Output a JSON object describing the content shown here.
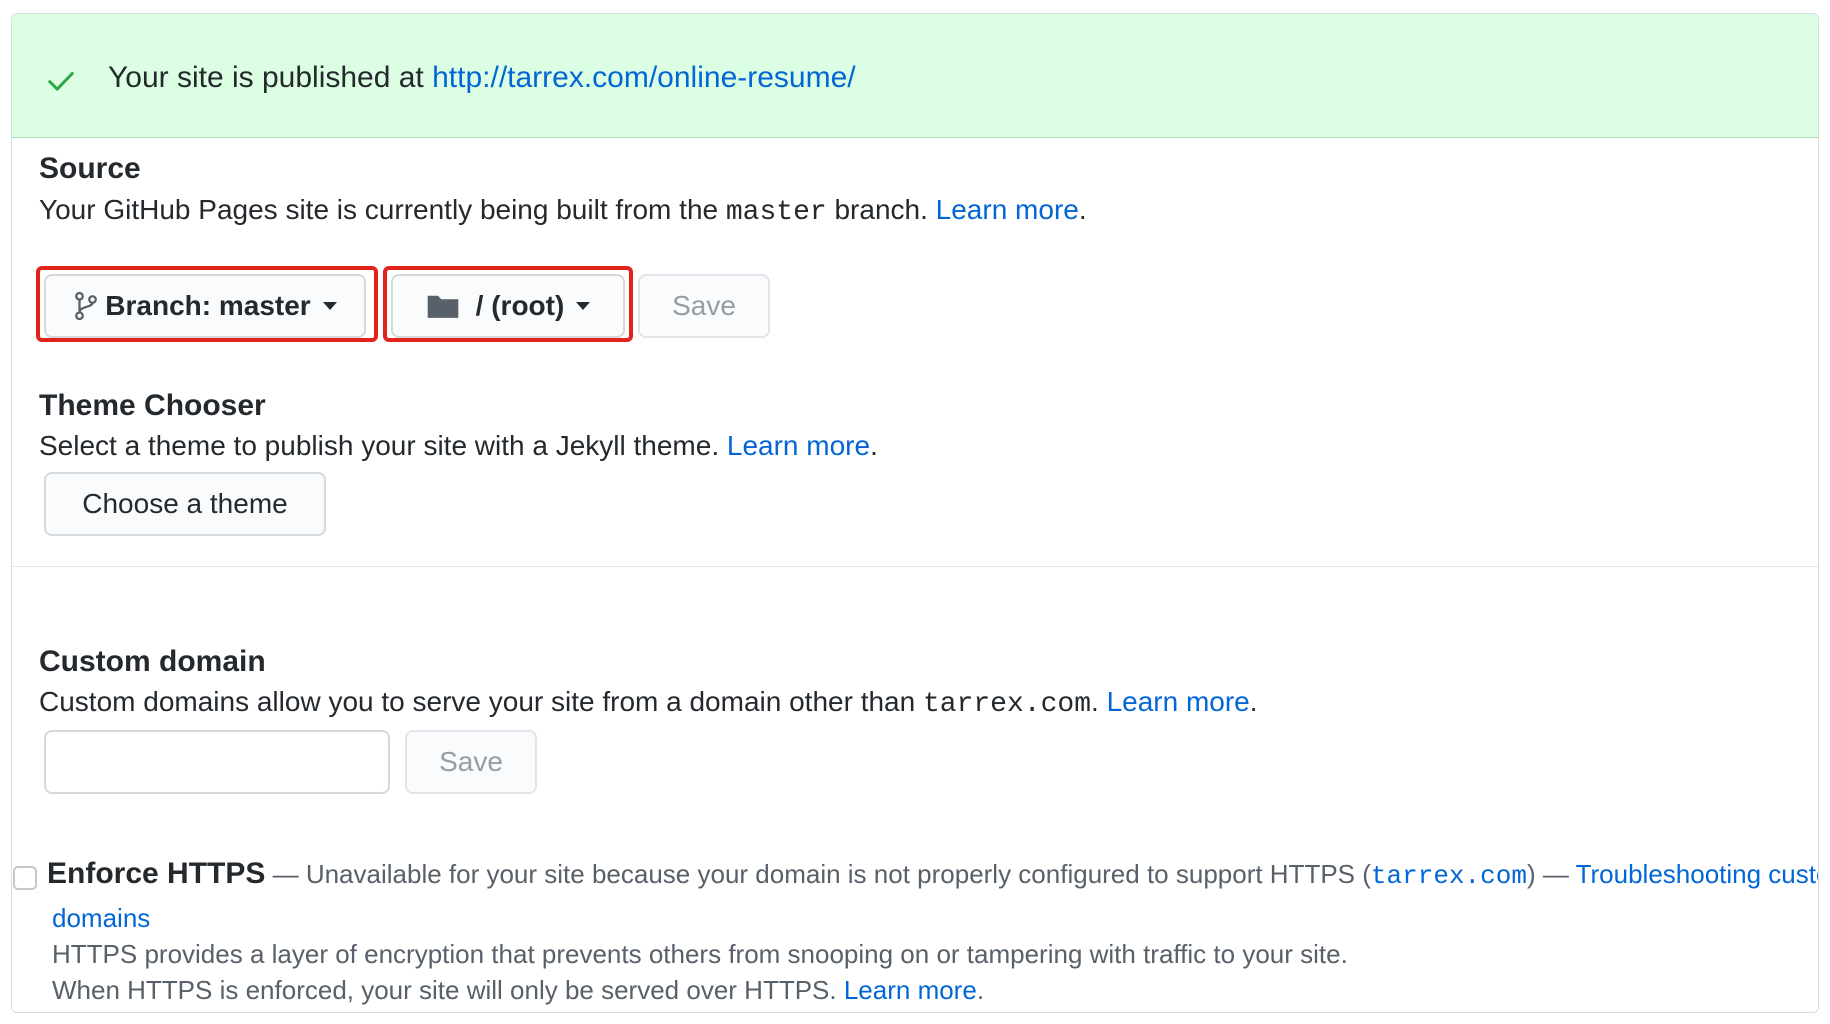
{
  "banner": {
    "icon": "check-icon",
    "text": "Your site is published at ",
    "url": "http://tarrex.com/online-resume/",
    "background": "#dcffe4",
    "icon_color": "#28a745"
  },
  "source": {
    "title": "Source",
    "desc_before": "Your GitHub Pages site is currently being built from the ",
    "branch_code": "master",
    "desc_after": " branch. ",
    "learn_more": "Learn more",
    "period": ".",
    "branch_button": {
      "icon": "git-branch-icon",
      "label": "Branch: master"
    },
    "folder_button": {
      "icon": "folder-icon",
      "label": "/ (root)"
    },
    "save_label": "Save",
    "highlight_color": "#e1231c"
  },
  "theme": {
    "title": "Theme Chooser",
    "desc": "Select a theme to publish your site with a Jekyll theme. ",
    "learn_more": "Learn more",
    "period": ".",
    "button_label": "Choose a theme"
  },
  "custom_domain": {
    "title": "Custom domain",
    "desc": "Custom domains allow you to serve your site from a domain other than ",
    "domain_code": "tarrex.com",
    "period_after_code": ". ",
    "learn_more": "Learn more",
    "period": ".",
    "input_value": "",
    "save_label": "Save"
  },
  "https": {
    "title": "Enforce HTTPS",
    "dash1": " — Unavailable for your site because your domain is not properly configured to support HTTPS (",
    "domain_code": "tarrex.com",
    "dash2": ") — ",
    "troubleshoot_line1": "Troubleshooting custom",
    "troubleshoot_line2": "domains",
    "note1": "HTTPS provides a layer of encryption that prevents others from snooping on or tampering with traffic to your site.",
    "note2": "When HTTPS is enforced, your site will only be served over HTTPS. ",
    "learn_more": "Learn more",
    "period": ".",
    "checked": false
  },
  "colors": {
    "link": "#0366d6",
    "text": "#24292e",
    "muted": "#586069"
  }
}
